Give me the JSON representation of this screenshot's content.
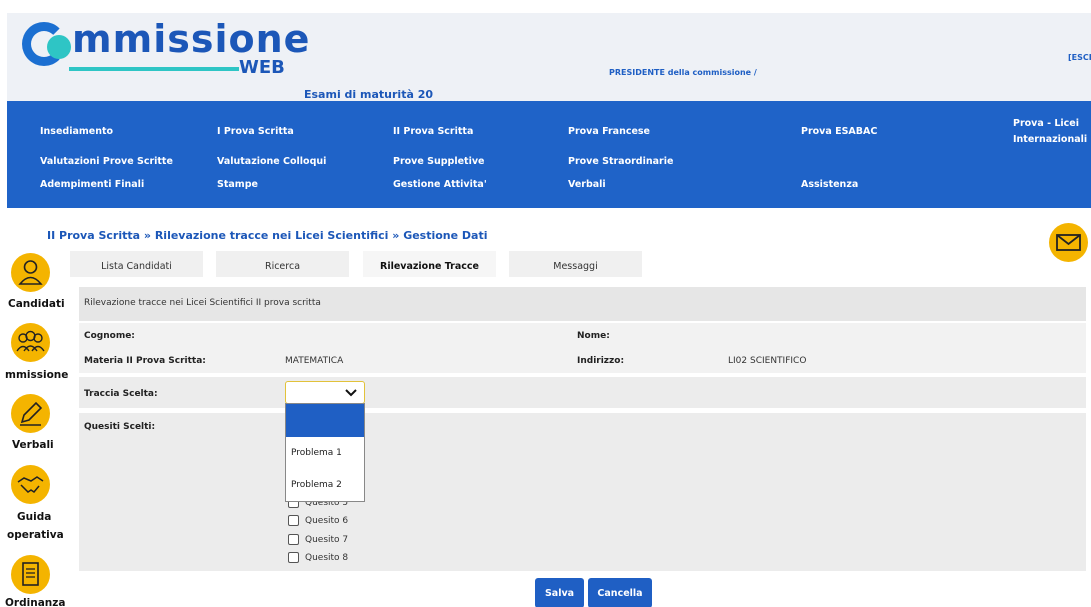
{
  "header": {
    "logo_main": "mmissione",
    "logo_web": "WEB",
    "subtitle": "Esami di maturità 20",
    "president": "PRESIDENTE della commissione /",
    "logout": "[ESCI]"
  },
  "nav": {
    "items": [
      "Insediamento",
      "I Prova Scritta",
      "II Prova Scritta",
      "Prova Francese",
      "Prova ESABAC",
      "Prova - Licei Internazionali",
      "Valutazioni Prove Scritte",
      "Valutazione Colloqui",
      "Prove Suppletive",
      "Prove Straordinarie",
      "Adempimenti Finali",
      "Stampe",
      "Gestione Attivita'",
      "Verbali",
      "Assistenza"
    ]
  },
  "breadcrumb": {
    "part1": "II Prova Scritta",
    "sep": " » ",
    "part2": "Rilevazione tracce nei Licei Scientifici",
    "part3": "Gestione Dati"
  },
  "sidebar": {
    "items": [
      "Candidati",
      "mmissione",
      "Verbali",
      "Guida",
      "operativa",
      "Ordinanza"
    ]
  },
  "tabs": [
    "Lista Candidati",
    "Ricerca",
    "Rilevazione Tracce",
    "Messaggi"
  ],
  "form": {
    "section_title": "Rilevazione tracce nei Licei Scientifici II prova scritta",
    "cognome_label": "Cognome:",
    "nome_label": "Nome:",
    "materia_label": "Materia II Prova Scritta:",
    "materia_value": "MATEMATICA",
    "indirizzo_label": "Indirizzo:",
    "indirizzo_value": "LI02 SCIENTIFICO",
    "traccia_label": "Traccia Scelta:",
    "quesiti_label": "Quesiti Scelti:",
    "traccia_options": [
      "",
      "Problema 1",
      "Problema 2"
    ],
    "quesiti": [
      "Quesito 5",
      "Quesito 6",
      "Quesito 7",
      "Quesito 8"
    ]
  },
  "buttons": {
    "save": "Salva",
    "cancel": "Cancella"
  },
  "colors": {
    "brand_blue": "#1f63c8",
    "accent_yellow": "#f4b400",
    "teal": "#2ec5c5"
  }
}
